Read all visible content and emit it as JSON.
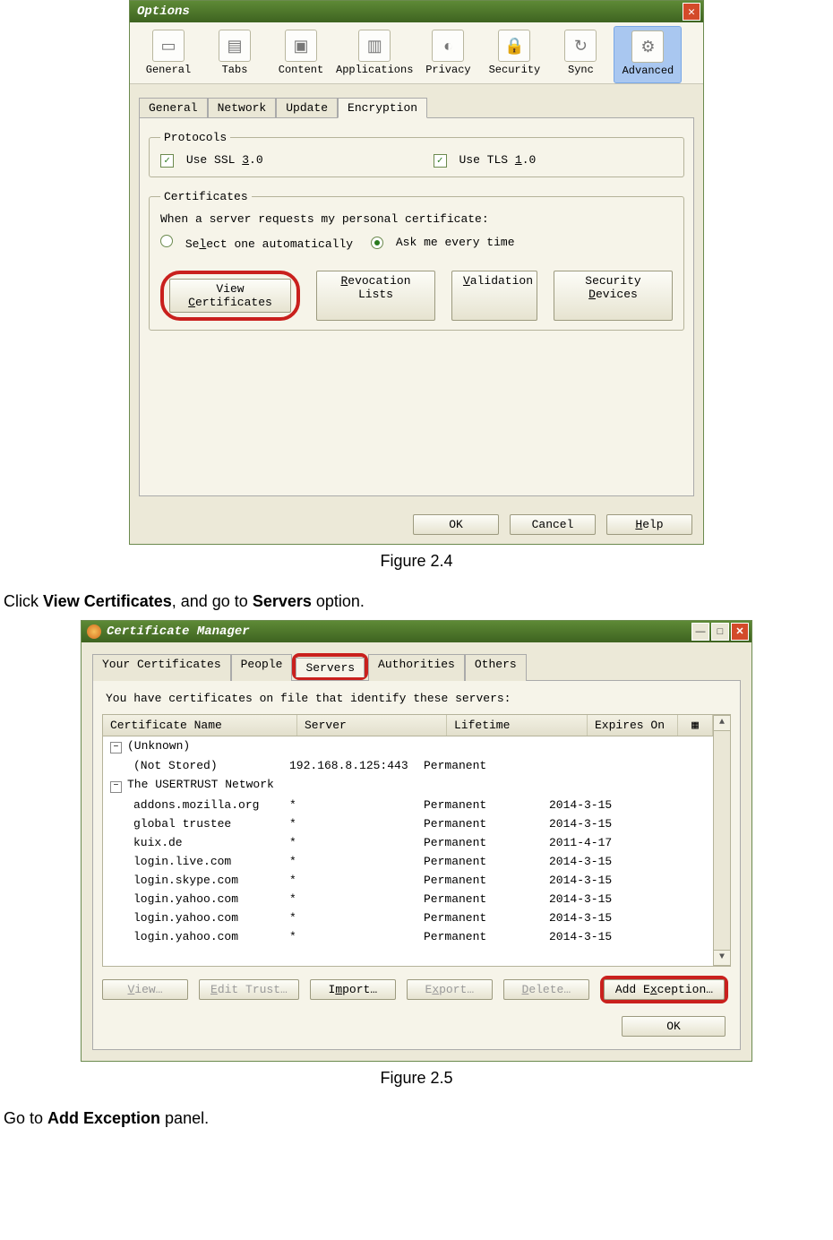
{
  "win1": {
    "title": "Options",
    "toolbar": [
      {
        "label": "General",
        "icon": "▭"
      },
      {
        "label": "Tabs",
        "icon": "▤"
      },
      {
        "label": "Content",
        "icon": "▣"
      },
      {
        "label": "Applications",
        "icon": "▥"
      },
      {
        "label": "Privacy",
        "icon": "◐"
      },
      {
        "label": "Security",
        "icon": "🔒"
      },
      {
        "label": "Sync",
        "icon": "↻"
      },
      {
        "label": "Advanced",
        "icon": "⚙",
        "selected": true
      }
    ],
    "subtabs": [
      "General",
      "Network",
      "Update",
      "Encryption"
    ],
    "subtab_selected": "Encryption",
    "protocols": {
      "legend": "Protocols",
      "ssl": {
        "checked": true,
        "pre": "Use SSL ",
        "u": "3",
        "post": ".0"
      },
      "tls": {
        "checked": true,
        "pre": "Use TLS ",
        "u": "1",
        "post": ".0"
      }
    },
    "certs": {
      "legend": "Certificates",
      "prompt": "When a server requests my personal certificate:",
      "auto": {
        "selected": false,
        "pre": "Se",
        "u": "l",
        "post": "ect one automatically"
      },
      "ask": {
        "selected": true,
        "label": "Ask me every time"
      },
      "buttons": {
        "view": {
          "pre": "View ",
          "u": "C",
          "post": "ertificates"
        },
        "rev": {
          "pre": "",
          "u": "R",
          "post": "evocation Lists"
        },
        "val": {
          "pre": "",
          "u": "V",
          "post": "alidation"
        },
        "sec": {
          "pre": "Security ",
          "u": "D",
          "post": "evices"
        }
      }
    },
    "footer": {
      "ok": "OK",
      "cancel": "Cancel",
      "help_u": "H",
      "help_post": "elp"
    }
  },
  "caption1": "Figure 2.4",
  "instr1": {
    "pre": "Click ",
    "b1": "View Certificates",
    "mid": ", and go to ",
    "b2": "Servers",
    "post": " option."
  },
  "win2": {
    "title": "Certificate Manager",
    "tabs": [
      "Your Certificates",
      "People",
      "Servers",
      "Authorities",
      "Others"
    ],
    "tab_selected": "Servers",
    "desc": "You have certificates on file that identify these servers:",
    "headers": {
      "name": "Certificate Name",
      "server": "Server",
      "life": "Lifetime",
      "exp": "Expires On"
    },
    "groups": [
      {
        "name": "(Unknown)",
        "rows": [
          {
            "name": "(Not Stored)",
            "server": "192.168.8.125:443",
            "life": "Permanent",
            "exp": ""
          }
        ]
      },
      {
        "name": "The USERTRUST Network",
        "rows": [
          {
            "name": "addons.mozilla.org",
            "server": "*",
            "life": "Permanent",
            "exp": "2014-3-15"
          },
          {
            "name": "global trustee",
            "server": "*",
            "life": "Permanent",
            "exp": "2014-3-15"
          },
          {
            "name": "kuix.de",
            "server": "*",
            "life": "Permanent",
            "exp": "2011-4-17"
          },
          {
            "name": "login.live.com",
            "server": "*",
            "life": "Permanent",
            "exp": "2014-3-15"
          },
          {
            "name": "login.skype.com",
            "server": "*",
            "life": "Permanent",
            "exp": "2014-3-15"
          },
          {
            "name": "login.yahoo.com",
            "server": "*",
            "life": "Permanent",
            "exp": "2014-3-15"
          },
          {
            "name": "login.yahoo.com",
            "server": "*",
            "life": "Permanent",
            "exp": "2014-3-15"
          },
          {
            "name": "login.yahoo.com",
            "server": "*",
            "life": "Permanent",
            "exp": "2014-3-15"
          }
        ]
      }
    ],
    "buttons": {
      "view": {
        "u": "V",
        "post": "iew…",
        "disabled": true
      },
      "edit": {
        "pre": "",
        "u": "E",
        "post": "dit Trust…",
        "disabled": true
      },
      "import": {
        "pre": "I",
        "u": "m",
        "post": "port…"
      },
      "export": {
        "pre": "E",
        "u": "x",
        "post": "port…",
        "disabled": true
      },
      "del": {
        "pre": "",
        "u": "D",
        "post": "elete…",
        "disabled": true
      },
      "add": {
        "pre": "Add E",
        "u": "x",
        "post": "ception…"
      }
    },
    "ok": "OK"
  },
  "caption2": "Figure 2.5",
  "instr2": {
    "pre": "Go to ",
    "b": "Add Exception",
    "post": " panel."
  }
}
